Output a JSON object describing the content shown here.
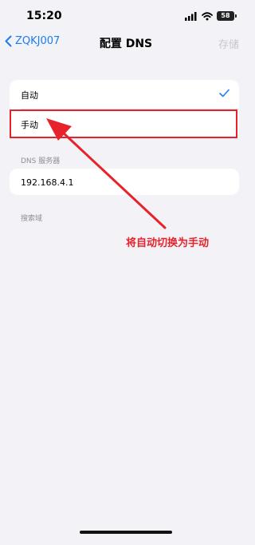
{
  "status_bar": {
    "time": "15:20",
    "battery": "58"
  },
  "nav": {
    "back_label": "ZQKJ007",
    "title": "配置 DNS",
    "save_label": "存储"
  },
  "dns_mode": {
    "options": [
      {
        "label": "自动",
        "selected": true
      },
      {
        "label": "手动",
        "selected": false
      }
    ]
  },
  "dns_servers": {
    "section_label": "DNS 服务器",
    "servers": [
      "192.168.4.1"
    ]
  },
  "search_domains": {
    "section_label": "搜索域"
  },
  "annotation": {
    "text": "将自动切换为手动"
  },
  "colors": {
    "accent": "#1c7cf4",
    "annotation": "#e8222a",
    "background": "#f2f2f7"
  }
}
